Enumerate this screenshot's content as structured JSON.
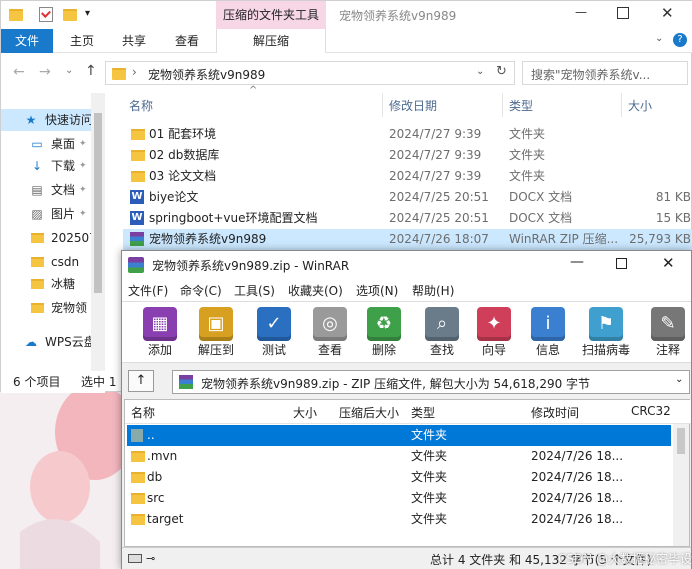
{
  "explorer": {
    "title": "宠物领养系统v9n989",
    "ribbon_contextual": "压缩的文件夹工具",
    "tabs": [
      "文件",
      "主页",
      "共享",
      "查看",
      "解压缩"
    ],
    "address_path": "宠物领养系统v9n989",
    "search_placeholder": "搜索\"宠物领养系统v...",
    "columns": [
      "名称",
      "修改日期",
      "类型",
      "大小"
    ],
    "files": [
      {
        "name": "01 配套环境",
        "date": "2024/7/27 9:39",
        "type": "文件夹",
        "size": "",
        "icon": "folder"
      },
      {
        "name": "02 db数据库",
        "date": "2024/7/27 9:39",
        "type": "文件夹",
        "size": "",
        "icon": "folder"
      },
      {
        "name": "03 论文文档",
        "date": "2024/7/27 9:39",
        "type": "文件夹",
        "size": "",
        "icon": "folder"
      },
      {
        "name": "biye论文",
        "date": "2024/7/25 20:51",
        "type": "DOCX 文档",
        "size": "81 KB",
        "icon": "word"
      },
      {
        "name": "springboot+vue环境配置文档",
        "date": "2024/7/25 20:51",
        "type": "DOCX 文档",
        "size": "15 KB",
        "icon": "word"
      },
      {
        "name": "宠物领养系统v9n989",
        "date": "2024/7/26 18:07",
        "type": "WinRAR ZIP 压缩...",
        "size": "25,793 KB",
        "icon": "rar"
      }
    ],
    "nav": [
      {
        "label": "快速访问",
        "icon": "star"
      },
      {
        "label": "桌面",
        "icon": "desktop"
      },
      {
        "label": "下载",
        "icon": "download"
      },
      {
        "label": "文档",
        "icon": "doc"
      },
      {
        "label": "图片",
        "icon": "picture"
      },
      {
        "label": "202507",
        "icon": "folder"
      },
      {
        "label": "csdn",
        "icon": "folder"
      },
      {
        "label": "冰糖",
        "icon": "folder"
      },
      {
        "label": "宠物领",
        "icon": "folder"
      },
      {
        "label": "WPS云盘",
        "icon": "cloud"
      }
    ],
    "status_count": "6 个项目",
    "status_selected": "选中 1"
  },
  "winrar": {
    "title": "宠物领养系统v9n989.zip - WinRAR",
    "menus": [
      "文件(F)",
      "命令(C)",
      "工具(S)",
      "收藏夹(O)",
      "选项(N)",
      "帮助(H)"
    ],
    "tools": [
      {
        "label": "添加",
        "icon": "add-icon"
      },
      {
        "label": "解压到",
        "icon": "extract-icon"
      },
      {
        "label": "测试",
        "icon": "test-icon"
      },
      {
        "label": "查看",
        "icon": "view-icon"
      },
      {
        "label": "删除",
        "icon": "delete-icon"
      },
      {
        "label": "查找",
        "icon": "find-icon"
      },
      {
        "label": "向导",
        "icon": "wizard-icon"
      },
      {
        "label": "信息",
        "icon": "info-icon"
      },
      {
        "label": "扫描病毒",
        "icon": "scan-icon"
      },
      {
        "label": "注释",
        "icon": "comment-icon"
      }
    ],
    "path_text": "宠物领养系统v9n989.zip - ZIP 压缩文件, 解包大小为 54,618,290 字节",
    "columns": [
      "名称",
      "大小",
      "压缩后大小",
      "类型",
      "修改时间",
      "CRC32"
    ],
    "files": [
      {
        "name": "..",
        "size": "",
        "packed": "",
        "type": "文件夹",
        "mtime": "",
        "selected": true
      },
      {
        "name": ".mvn",
        "size": "",
        "packed": "",
        "type": "文件夹",
        "mtime": "2024/7/26 18..."
      },
      {
        "name": "db",
        "size": "",
        "packed": "",
        "type": "文件夹",
        "mtime": "2024/7/26 18..."
      },
      {
        "name": "src",
        "size": "",
        "packed": "",
        "type": "文件夹",
        "mtime": "2024/7/26 18..."
      },
      {
        "name": "target",
        "size": "",
        "packed": "",
        "type": "文件夹",
        "mtime": "2024/7/26 18..."
      }
    ],
    "status": "总计 4 文件夹 和 45,132 字节(5 个文件)",
    "watermark": "CSDN @大数据秘密毕设"
  },
  "colors": {
    "accent": "#1979ca",
    "selection": "#0078d7",
    "ribbon_pink": "#f7d6e6"
  }
}
